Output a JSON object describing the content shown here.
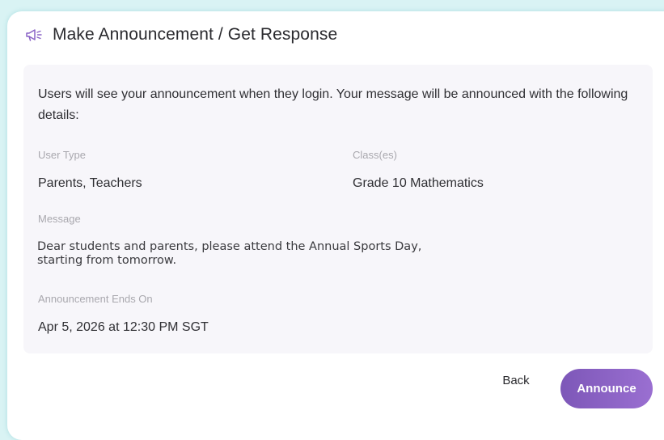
{
  "header": {
    "icon": "megaphone-icon",
    "title": "Make Announcement / Get Response"
  },
  "details": {
    "intro": "Users will see your announcement when they login. Your message will be announced with the following details:",
    "user_type_label": "User Type",
    "user_type_value": "Parents, Teachers",
    "classes_label": "Class(es)",
    "classes_value": "Grade 10 Mathematics",
    "message_label": "Message",
    "message_line1": "Dear students and parents, please attend the Annual Sports Day,",
    "message_line2": "starting from tomorrow.",
    "ends_label": "Announcement Ends On",
    "ends_value": "Apr 5, 2026 at 12:30 PM SGT"
  },
  "actions": {
    "back_label": "Back",
    "announce_label": "Announce"
  },
  "colors": {
    "accent": "#8a63c6",
    "backdrop": "#d9f3f4",
    "panel": "#f7f6fa"
  }
}
